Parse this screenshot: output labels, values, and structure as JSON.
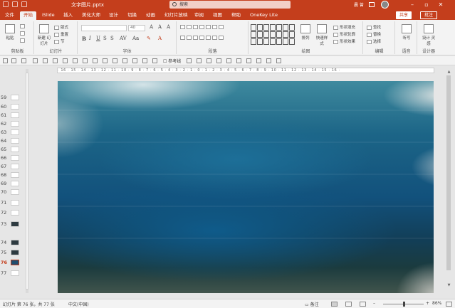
{
  "titlebar": {
    "document_title": "文字图片.pptx",
    "search_placeholder": "搜索",
    "account_name": "晨 曾"
  },
  "tabs": [
    "文件",
    "开始",
    "iSlide",
    "插入",
    "美化大师",
    "设计",
    "切换",
    "动画",
    "幻灯片放映",
    "审阅",
    "视图",
    "帮助",
    "OneKey Lite"
  ],
  "active_tab": "开始",
  "share_label": "共享",
  "comment_label": "批注",
  "ribbon": {
    "groups": [
      "剪贴板",
      "幻灯片",
      "字体",
      "段落",
      "绘图",
      "编辑",
      "语音",
      "设计器"
    ],
    "paste": "粘贴",
    "new_slide": "新建\n幻灯片",
    "layout": "版式",
    "reset": "重置",
    "section": "节",
    "font_size": "40",
    "find": "查找",
    "replace": "替换",
    "select": "选择",
    "dictate": "听写",
    "design_ideas": "设计\n灵感",
    "arrange": "排列",
    "quick_styles": "快速样式",
    "shape_fill": "形状填充",
    "shape_outline": "形状轮廓",
    "shape_effects": "形状效果"
  },
  "toolbar2": {
    "ref_line": "参考线"
  },
  "ruler_text": "· 16 · 15 · 14 · 13 · 12 · 11 · 10 · 9 · 8 · 7 · 6 · 5 · 4 · 3 · 2 · 1 · 0 · 1 · 2 · 3 · 4 · 5 · 6 · 7 · 8 · 9 · 10 · 11 · 12 · 13 · 14 · 15 · 16 ·",
  "slides": [
    "59",
    "60",
    "61",
    "62",
    "63",
    "64",
    "65",
    "66",
    "67",
    "68",
    "69",
    "70",
    "71",
    "72",
    "73",
    "74",
    "75",
    "76",
    "77"
  ],
  "active_slide": "76",
  "statusbar": {
    "slide_info": "幻灯片 第 76 张，共 77 张",
    "language": "中文(中国)",
    "notes": "备注",
    "zoom": "86%"
  }
}
